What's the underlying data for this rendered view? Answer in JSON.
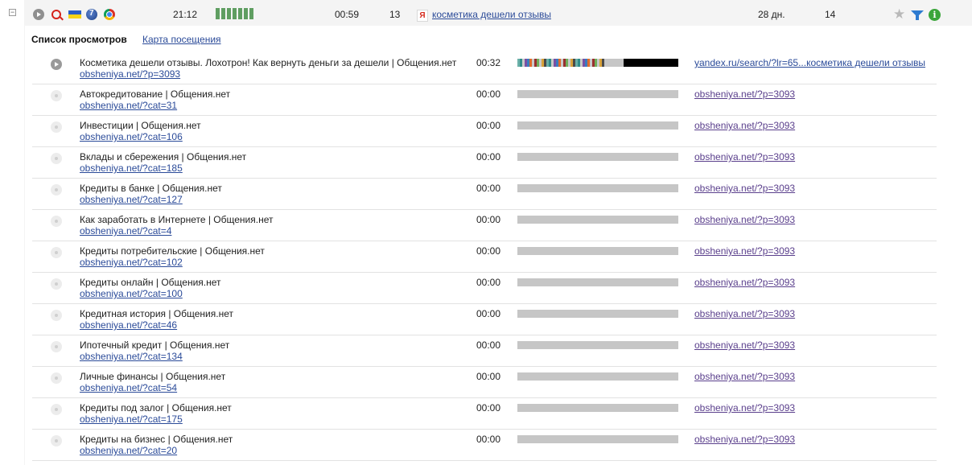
{
  "visit": {
    "time": "21:12",
    "duration": "00:59",
    "pages_count": "13",
    "search_engine_badge": "Я",
    "search_query": "косметика дешели отзывы",
    "days_ago": "28 дн.",
    "visits_count": "14",
    "activity_bars": 7,
    "icons": [
      "play-icon",
      "search-icon",
      "ukraine-flag-icon",
      "windows7-icon",
      "chrome-icon",
      "star-icon",
      "filter-icon",
      "info-icon"
    ],
    "colors": {
      "activity": "#5f9e61",
      "link": "#2b4b99",
      "visited_link": "#5a3f8c",
      "bar_empty": "#c6c6c6"
    }
  },
  "section": {
    "title": "Список просмотров",
    "map_link": "Карта посещения"
  },
  "pageviews": [
    {
      "title": "Косметика дешели отзывы. Лохотрон! Как вернуть деньги за дешели | Общения.нет",
      "url": "obsheniya.net/?p=3093",
      "time": "00:32",
      "referrer": "yandex.ru/search/?lr=65...косметика дешели отзывы",
      "active": true
    },
    {
      "title": "Автокредитование | Общения.нет",
      "url": "obsheniya.net/?cat=31",
      "time": "00:00",
      "referrer": "obsheniya.net/?p=3093",
      "active": false
    },
    {
      "title": "Инвестиции | Общения.нет",
      "url": "obsheniya.net/?cat=106",
      "time": "00:00",
      "referrer": "obsheniya.net/?p=3093",
      "active": false
    },
    {
      "title": "Вклады и сбережения | Общения.нет",
      "url": "obsheniya.net/?cat=185",
      "time": "00:00",
      "referrer": "obsheniya.net/?p=3093",
      "active": false
    },
    {
      "title": "Кредиты в банке | Общения.нет",
      "url": "obsheniya.net/?cat=127",
      "time": "00:00",
      "referrer": "obsheniya.net/?p=3093",
      "active": false
    },
    {
      "title": "Как заработать в Интернете | Общения.нет",
      "url": "obsheniya.net/?cat=4",
      "time": "00:00",
      "referrer": "obsheniya.net/?p=3093",
      "active": false
    },
    {
      "title": "Кредиты потребительские | Общения.нет",
      "url": "obsheniya.net/?cat=102",
      "time": "00:00",
      "referrer": "obsheniya.net/?p=3093",
      "active": false
    },
    {
      "title": "Кредиты онлайн | Общения.нет",
      "url": "obsheniya.net/?cat=100",
      "time": "00:00",
      "referrer": "obsheniya.net/?p=3093",
      "active": false
    },
    {
      "title": "Кредитная история | Общения.нет",
      "url": "obsheniya.net/?cat=46",
      "time": "00:00",
      "referrer": "obsheniya.net/?p=3093",
      "active": false
    },
    {
      "title": "Ипотечный кредит | Общения.нет",
      "url": "obsheniya.net/?cat=134",
      "time": "00:00",
      "referrer": "obsheniya.net/?p=3093",
      "active": false
    },
    {
      "title": "Личные финансы | Общения.нет",
      "url": "obsheniya.net/?cat=54",
      "time": "00:00",
      "referrer": "obsheniya.net/?p=3093",
      "active": false
    },
    {
      "title": "Кредиты под залог | Общения.нет",
      "url": "obsheniya.net/?cat=175",
      "time": "00:00",
      "referrer": "obsheniya.net/?p=3093",
      "active": false
    },
    {
      "title": "Кредиты на бизнес | Общения.нет",
      "url": "obsheniya.net/?cat=20",
      "time": "00:00",
      "referrer": "obsheniya.net/?p=3093",
      "active": false
    }
  ]
}
